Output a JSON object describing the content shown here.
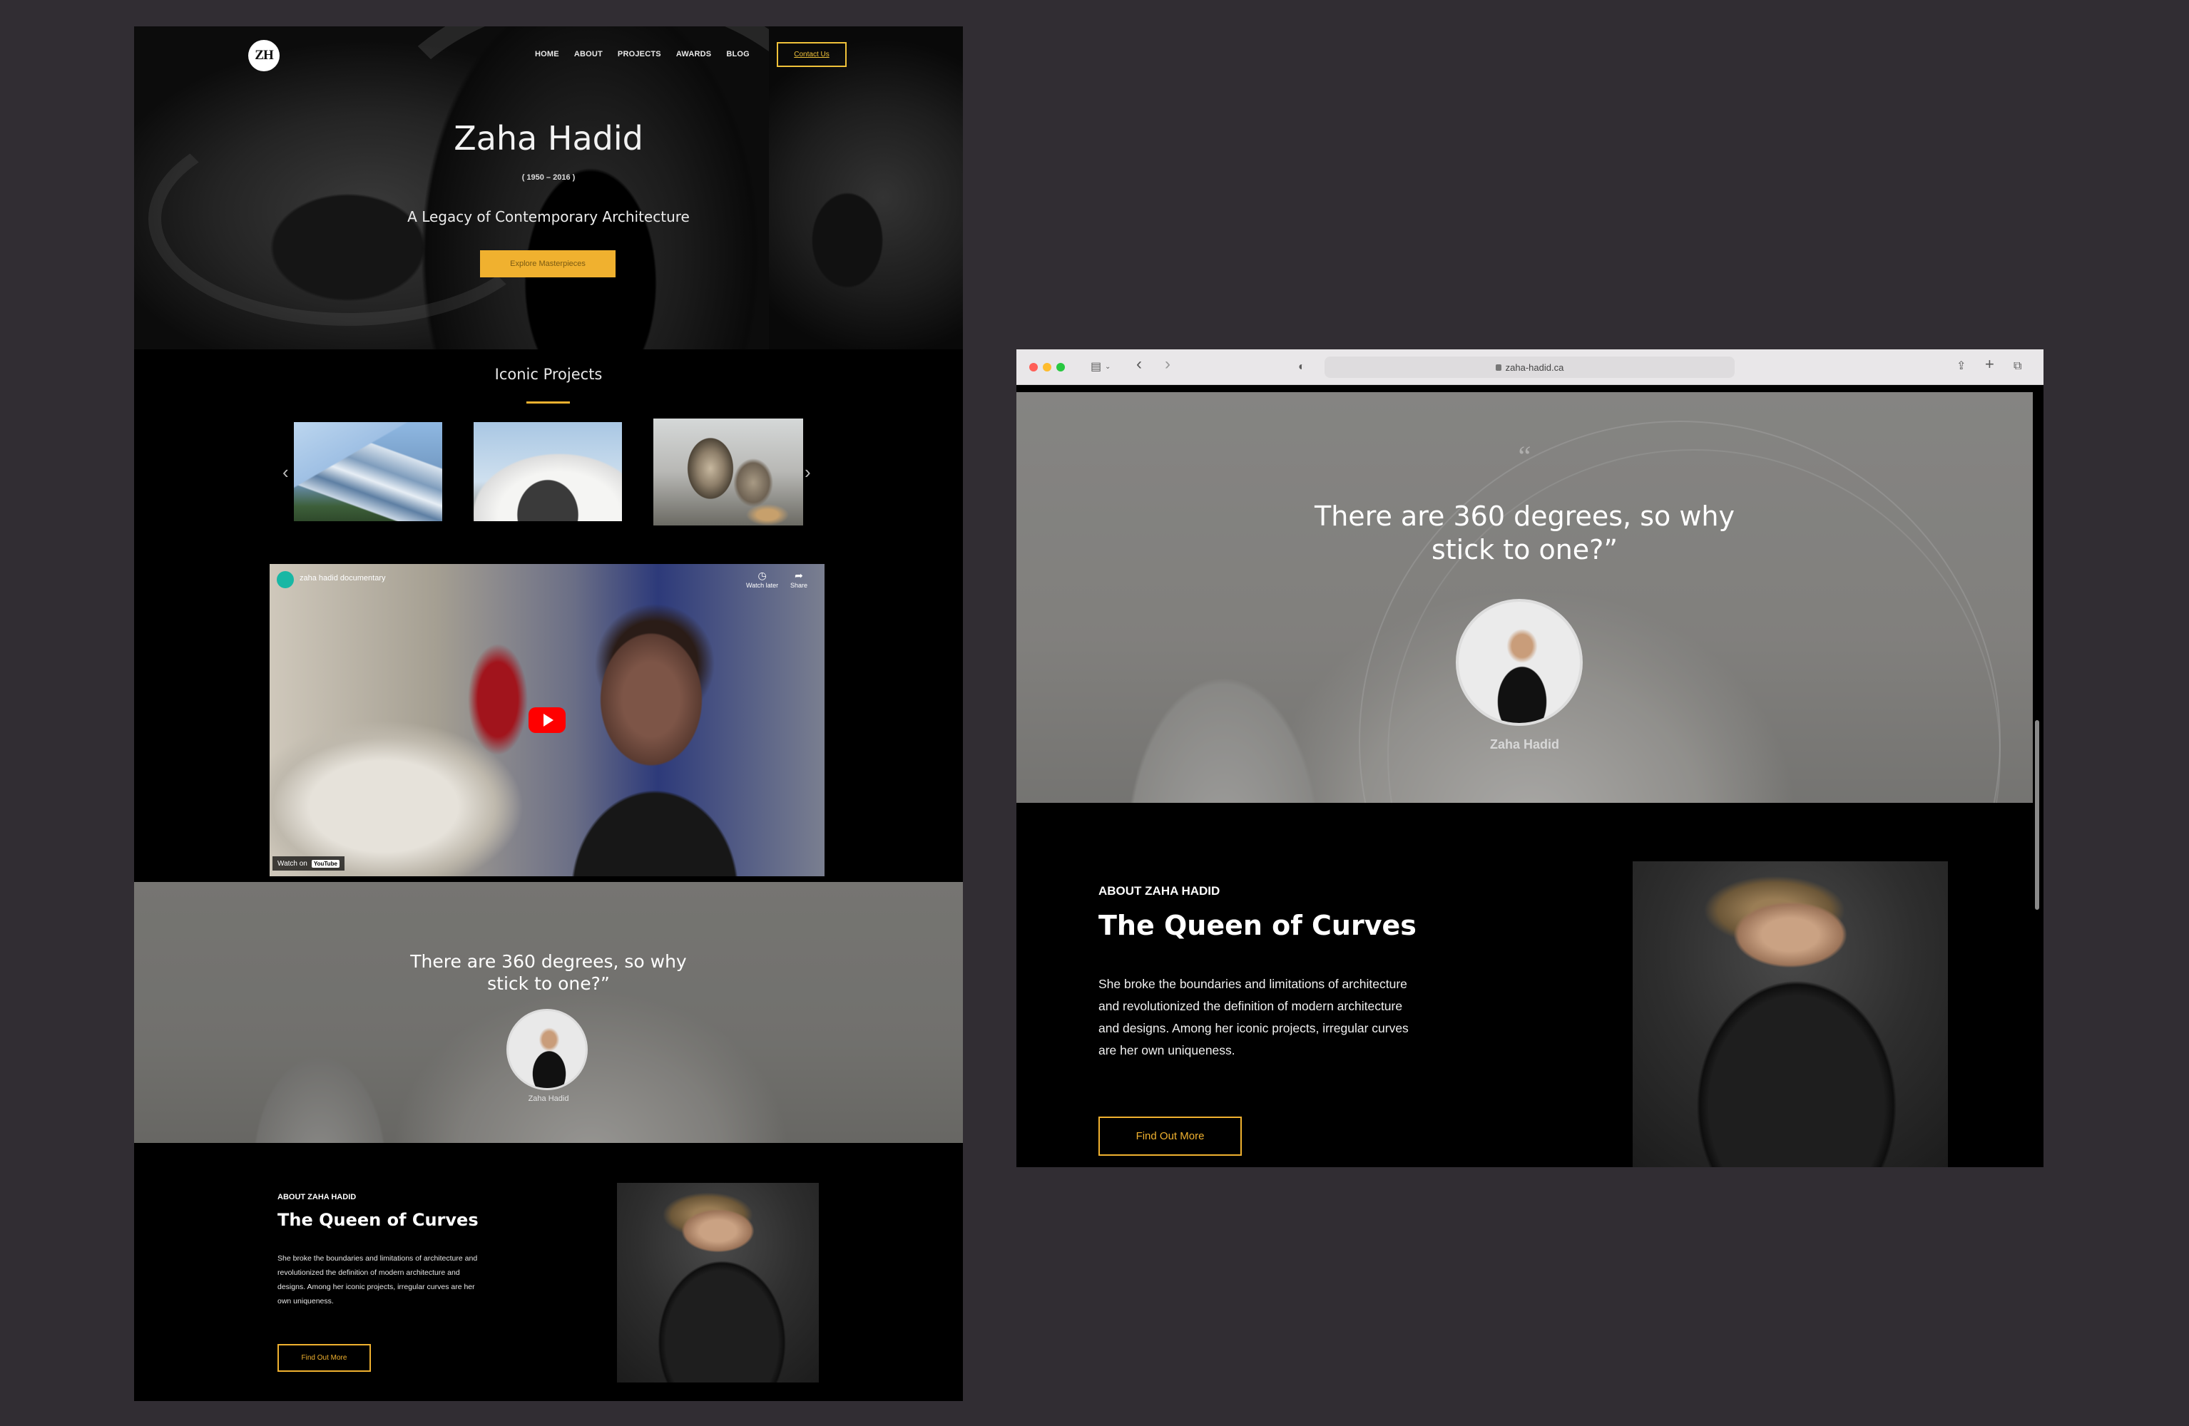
{
  "left_page": {
    "logo": "ZH",
    "nav": [
      "HOME",
      "ABOUT",
      "PROJECTS",
      "AWARDS",
      "BLOG"
    ],
    "contact": "Contact Us",
    "hero": {
      "title": "Zaha Hadid",
      "years": "( 1950 – 2016 )",
      "subtitle": "A Legacy of Contemporary Architecture",
      "button": "Explore Masterpieces"
    },
    "projects": {
      "title": "Iconic Projects",
      "prev": "‹",
      "next": "›"
    },
    "video": {
      "channel_title": "zaha hadid documentary",
      "watch_later": "Watch later",
      "share": "Share",
      "watch_on": "Watch on",
      "yt": "YouTube"
    },
    "quote": {
      "text": "There are 360 degrees, so why stick to one?”",
      "author": "Zaha Hadid"
    },
    "about": {
      "tag": "ABOUT ZAHA HADID",
      "heading": "The Queen of Curves",
      "body": "She broke the boundaries and limitations of architecture and revolutionized the definition of modern architecture and designs. Among her iconic projects, irregular curves are her own uniqueness.",
      "button": "Find Out More"
    }
  },
  "browser": {
    "url": "zaha-hadid.ca",
    "quote_mark": "“",
    "quote": {
      "text": "There are 360 degrees, so why stick to one?”",
      "author": "Zaha Hadid"
    },
    "about": {
      "tag": "ABOUT ZAHA HADID",
      "heading": "The Queen of Curves",
      "body": "She broke the boundaries and limitations of architecture and revolutionized the definition of modern architecture and designs. Among her iconic projects, irregular curves are her own uniqueness.",
      "button": "Find Out More"
    }
  },
  "icons": {
    "back": "‹",
    "forward": "›",
    "share": "⇪",
    "new_tab": "+",
    "tabs": "⧉",
    "sidebar": "▤",
    "shield": "◐"
  },
  "colors": {
    "accent": "#f0b12f",
    "background": "#312d33",
    "page": "#000000"
  }
}
